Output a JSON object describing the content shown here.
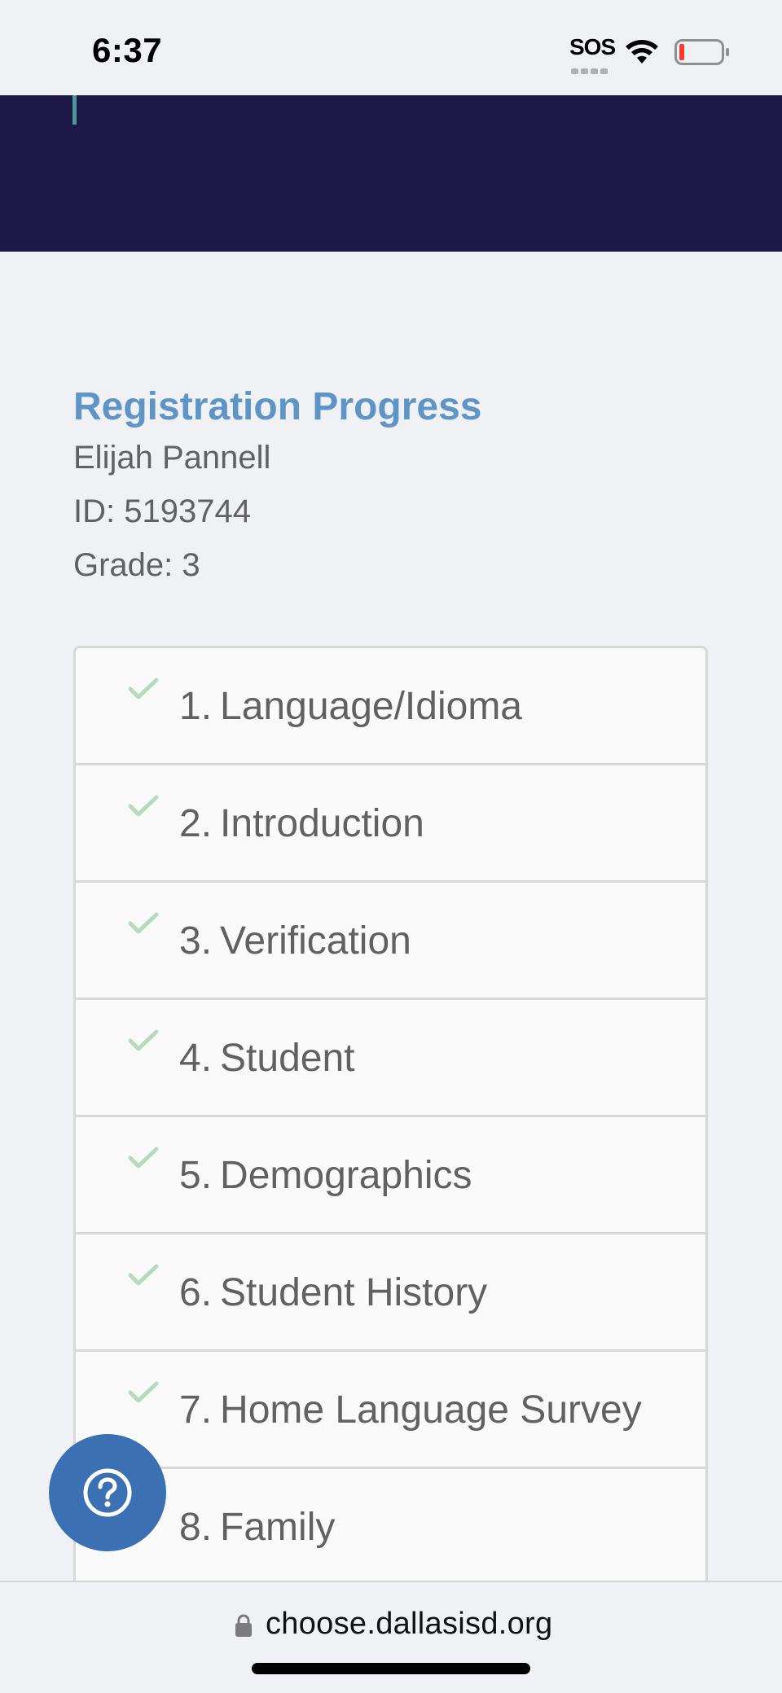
{
  "status_bar": {
    "time": "6:37",
    "sos": "SOS"
  },
  "registration": {
    "title": "Registration Progress",
    "student_name": "Elijah Pannell",
    "id_line": "ID: 5193744",
    "grade_line": "Grade: 3"
  },
  "steps": [
    {
      "num": "1.",
      "label": "Language/Idioma",
      "completed": true
    },
    {
      "num": "2.",
      "label": "Introduction",
      "completed": true
    },
    {
      "num": "3.",
      "label": "Verification",
      "completed": true
    },
    {
      "num": "4.",
      "label": "Student",
      "completed": true
    },
    {
      "num": "5.",
      "label": "Demographics",
      "completed": true
    },
    {
      "num": "6.",
      "label": "Student History",
      "completed": true
    },
    {
      "num": "7.",
      "label": "Home Language Survey",
      "completed": true
    },
    {
      "num": "8.",
      "label": "Family",
      "completed": false
    }
  ],
  "url_bar": {
    "domain": "choose.dallasisd.org"
  },
  "colors": {
    "header_bg": "#1e1848",
    "title_blue": "#5f95c6",
    "check_green": "#b9d8bd",
    "help_button": "#3b70b2"
  },
  "icons": {
    "help": "question-circle-icon",
    "check": "check-icon",
    "lock": "lock-icon"
  }
}
